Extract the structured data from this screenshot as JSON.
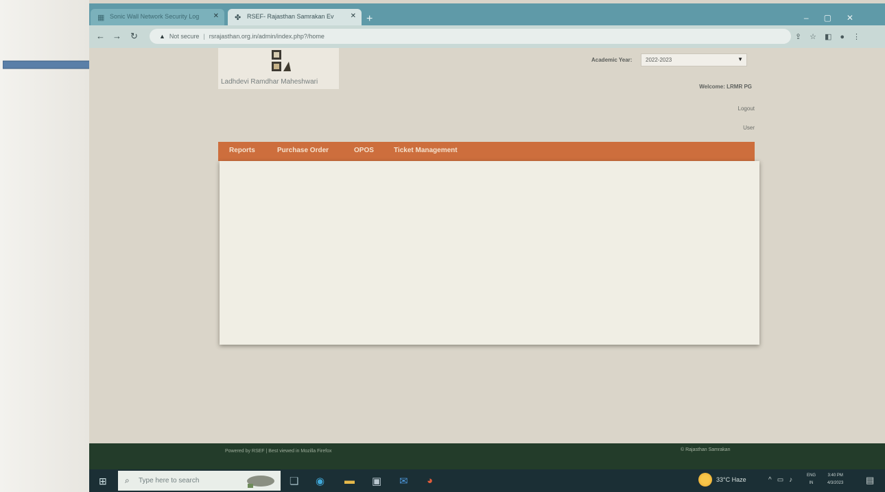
{
  "browser": {
    "tabs": [
      {
        "label": "Sonic Wall Network Security Log",
        "active": false
      },
      {
        "label": "RSEF- Rajasthan Samrakan Ev",
        "active": true
      }
    ],
    "address": {
      "security": "Not secure",
      "url": "rsrajasthan.org.in/admin/index.php?/home"
    }
  },
  "page": {
    "logo_label": "Ladhdevi Ramdhar Maheshwari",
    "academic_year_label": "Academic Year:",
    "academic_year_value": "2022-2023",
    "welcome_text": "Welcome: LRMR PG",
    "logout_label": "Logout",
    "user_label": "User",
    "nav": [
      "Reports",
      "Purchase Order",
      "OPOS",
      "Ticket Management"
    ]
  },
  "footer": {
    "left": "Powered by RSEF | Best viewed in Mozilla Firefox",
    "right": "© Rajasthan Samrakan"
  },
  "taskbar": {
    "search_placeholder": "Type here to search",
    "weather": "33°C Haze",
    "lang_top": "ENG",
    "lang_bottom": "IN",
    "time": "3:40 PM",
    "date": "4/3/2023"
  },
  "colors": {
    "nav_bar": "#cd6e3d",
    "tab_strip": "#5f9aa8",
    "footer": "#233c2a",
    "taskbar": "#1b2f35"
  },
  "icons": [
    "arrow-right-icon",
    "back-icon",
    "forward-icon",
    "reload-icon",
    "warning-icon",
    "share-icon",
    "star-icon",
    "extensions-icon",
    "profile-icon",
    "menu-icon",
    "windows-start-icon",
    "search-icon",
    "weather-icon",
    "notification-icon"
  ]
}
